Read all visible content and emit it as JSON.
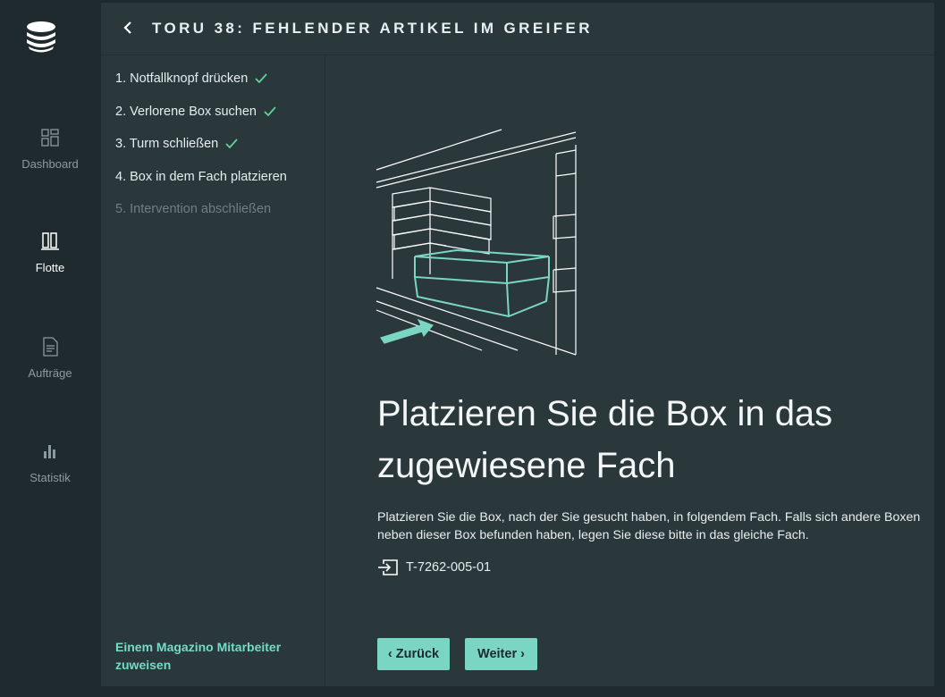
{
  "nav": {
    "items": [
      {
        "label": "Dashboard",
        "icon": "dashboard-icon",
        "active": false
      },
      {
        "label": "Flotte",
        "icon": "fleet-icon",
        "active": true
      },
      {
        "label": "Aufträge",
        "icon": "document-icon",
        "active": false
      },
      {
        "label": "Statistik",
        "icon": "bar-chart-icon",
        "active": false
      }
    ]
  },
  "header": {
    "title": "TORU 38: FEHLENDER ARTIKEL IM GREIFER",
    "back_icon": "chevron-left-icon"
  },
  "steps": [
    {
      "label": "1. Notfallknopf drücken",
      "done": true
    },
    {
      "label": "2. Verlorene Box suchen",
      "done": true
    },
    {
      "label": "3. Turm schließen",
      "done": true
    },
    {
      "label": "4. Box in dem Fach platzieren",
      "done": false
    },
    {
      "label": "5. Intervention abschließen",
      "done": false,
      "disabled": true
    }
  ],
  "assign_link": "Einem Magazino Mitarbeiter zuweisen",
  "content": {
    "headline": "Platzieren Sie die Box in das zugewiesene Fach",
    "description": "Platzieren Sie die Box, nach der Sie gesucht haben, in folgendem Fach. Falls sich andere Boxen neben dieser Box befunden haben, legen Sie diese bitte in das gleiche Fach.",
    "location_code": "T-7262-005-01",
    "location_icon": "enter-slot-icon"
  },
  "buttons": {
    "back": "Zurück",
    "next": "Weiter"
  },
  "colors": {
    "accent": "#7ad6c3",
    "check": "#5fd39a",
    "panel": "#2a373b",
    "nav_bg": "#1f2a2e"
  }
}
